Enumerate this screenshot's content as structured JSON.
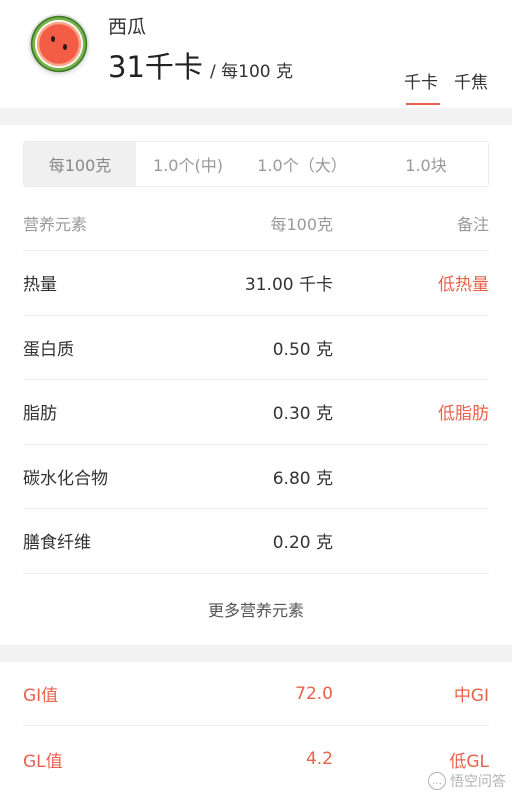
{
  "header": {
    "food_name": "西瓜",
    "calories_value": "31千卡",
    "calories_unit": "/ 每100 克",
    "unit_kcal": "千卡",
    "unit_kj": "千焦",
    "food_image_icon": "watermelon-icon"
  },
  "portion_tabs": [
    "每100克",
    "1.0个(中)",
    "1.0个（大）",
    "1.0块"
  ],
  "nutrition_table": {
    "headers": {
      "name": "营养元素",
      "value": "每100克",
      "note": "备注"
    },
    "rows": [
      {
        "name": "热量",
        "value": "31.00 千卡",
        "note": "低热量"
      },
      {
        "name": "蛋白质",
        "value": "0.50 克",
        "note": ""
      },
      {
        "name": "脂肪",
        "value": "0.30 克",
        "note": "低脂肪"
      },
      {
        "name": "碳水化合物",
        "value": "6.80 克",
        "note": ""
      },
      {
        "name": "膳食纤维",
        "value": "0.20 克",
        "note": ""
      }
    ],
    "more_label": "更多营养元素"
  },
  "gi_table": [
    {
      "name": "GI值",
      "value": "72.0",
      "note": "中GI"
    },
    {
      "name": "GL值",
      "value": "4.2",
      "note": "低GL"
    }
  ],
  "watermark": {
    "icon": "chat-bubble-icon",
    "text": "悟空问答"
  },
  "colors": {
    "accent": "#e8624d",
    "muted": "#999999",
    "background": "#f2f2f2"
  }
}
